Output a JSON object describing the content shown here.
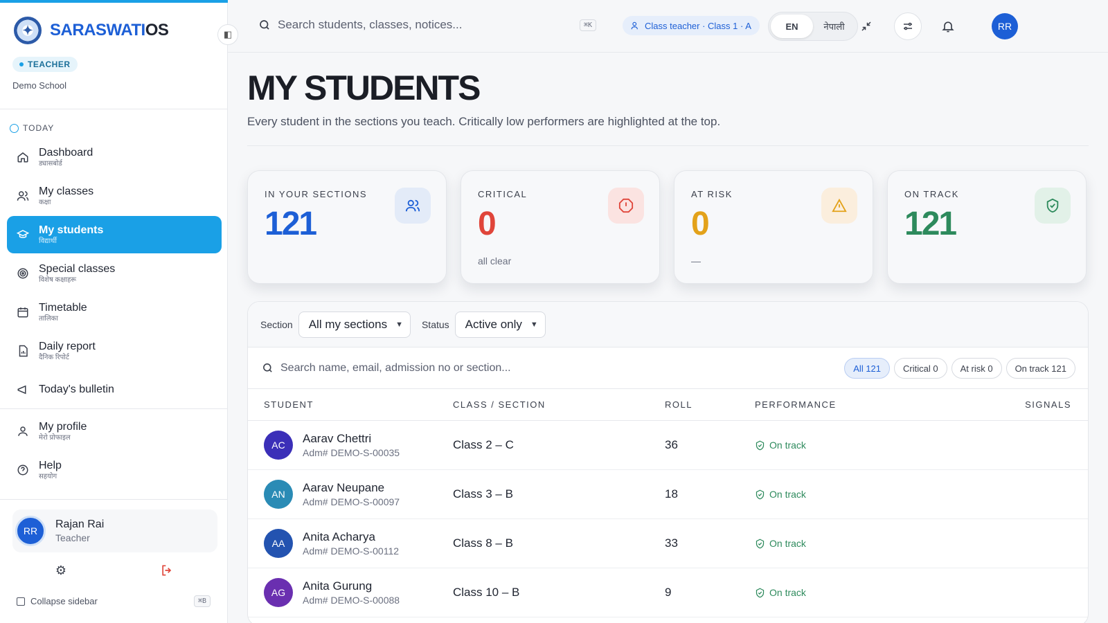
{
  "brand": {
    "name_part1": "SARASWATI",
    "name_part2": "OS"
  },
  "sidebar": {
    "role": "TEACHER",
    "school": "Demo School",
    "section_label": "TODAY",
    "items": [
      {
        "en": "Dashboard",
        "np": "ड्यासबोर्ड"
      },
      {
        "en": "My classes",
        "np": "कक्षा"
      },
      {
        "en": "My students",
        "np": "विद्यार्थी"
      },
      {
        "en": "Special classes",
        "np": "विशेष कक्षाहरू"
      },
      {
        "en": "Timetable",
        "np": "तालिका"
      },
      {
        "en": "Daily report",
        "np": "दैनिक रिपोर्ट"
      },
      {
        "en": "Today's bulletin",
        "np": ""
      }
    ],
    "secondary": [
      {
        "en": "My profile",
        "np": "मेरो प्रोफाइल"
      },
      {
        "en": "Help",
        "np": "सहयोग"
      }
    ],
    "user": {
      "initials": "RR",
      "name": "Rajan Rai",
      "role": "Teacher"
    },
    "collapse_label": "Collapse sidebar",
    "collapse_kbd": "⌘B"
  },
  "topbar": {
    "search_placeholder": "Search students, classes, notices...",
    "search_kbd": "⌘K",
    "class_pill": "Class teacher · Class 1 · A",
    "lang_en": "EN",
    "lang_np": "नेपाली",
    "avatar_initials": "RR"
  },
  "page": {
    "title": "MY STUDENTS",
    "subtitle": "Every student in the sections you teach. Critically low performers are highlighted at the top."
  },
  "stats": [
    {
      "label": "IN YOUR SECTIONS",
      "value": "121",
      "note": "",
      "color": "#1d5fd6",
      "icon_bg": "#e3ebf8",
      "icon_color": "#1d5fd6"
    },
    {
      "label": "CRITICAL",
      "value": "0",
      "note": "all clear",
      "color": "#e0453a",
      "icon_bg": "#fbe3e1",
      "icon_color": "#e0453a"
    },
    {
      "label": "AT RISK",
      "value": "0",
      "note": "—",
      "color": "#e3a21a",
      "icon_bg": "#fbeedd",
      "icon_color": "#e3a21a"
    },
    {
      "label": "ON TRACK",
      "value": "121",
      "note": "",
      "color": "#2d8a5c",
      "icon_bg": "#e2f1e8",
      "icon_color": "#2d8a5c"
    }
  ],
  "filters": {
    "section_label": "Section",
    "section_value": "All my sections",
    "status_label": "Status",
    "status_value": "Active only",
    "search_placeholder": "Search name, email, admission no or section...",
    "chips": [
      "All 121",
      "Critical 0",
      "At risk 0",
      "On track 121"
    ]
  },
  "table": {
    "headers": {
      "student": "STUDENT",
      "class": "CLASS / SECTION",
      "roll": "ROLL",
      "performance": "PERFORMANCE",
      "signals": "SIGNALS"
    },
    "rows": [
      {
        "initials": "AC",
        "name": "Aarav Chettri",
        "adm": "Adm# DEMO-S-00035",
        "class": "Class 2 – C",
        "roll": "36",
        "perf": "On track",
        "avatar_color": "#3b2fb8"
      },
      {
        "initials": "AN",
        "name": "Aarav Neupane",
        "adm": "Adm# DEMO-S-00097",
        "class": "Class 3 – B",
        "roll": "18",
        "perf": "On track",
        "avatar_color": "#2a8bb5"
      },
      {
        "initials": "AA",
        "name": "Anita Acharya",
        "adm": "Adm# DEMO-S-00112",
        "class": "Class 8 – B",
        "roll": "33",
        "perf": "On track",
        "avatar_color": "#2353b0"
      },
      {
        "initials": "AG",
        "name": "Anita Gurung",
        "adm": "Adm# DEMO-S-00088",
        "class": "Class 10 – B",
        "roll": "9",
        "perf": "On track",
        "avatar_color": "#6a2fb0"
      }
    ]
  }
}
